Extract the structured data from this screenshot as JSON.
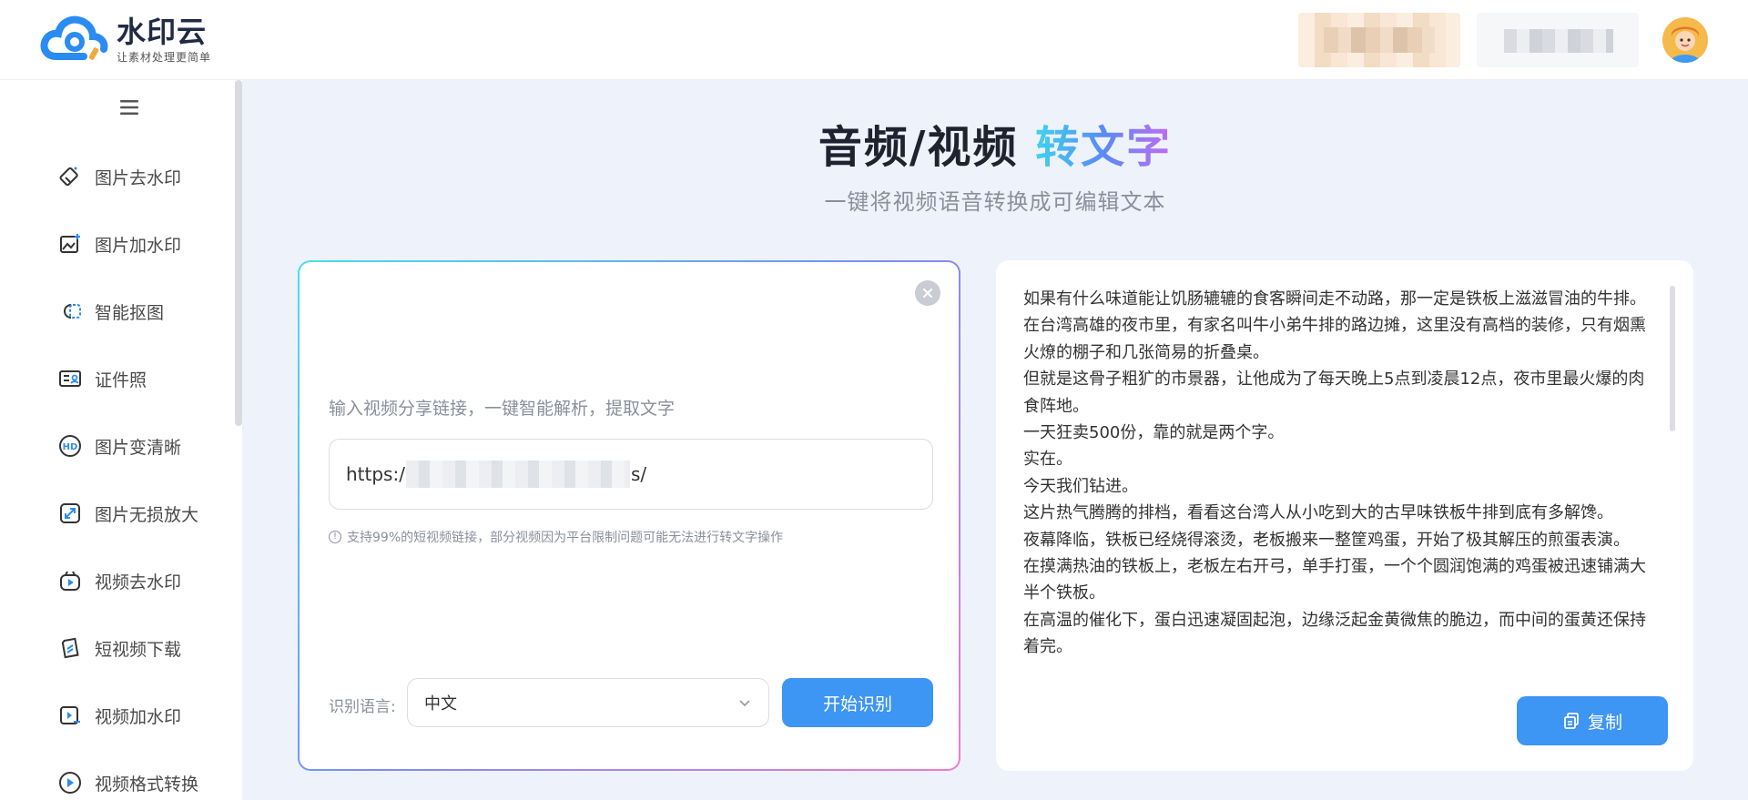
{
  "header": {
    "logo_name": "水印云",
    "logo_slogan": "让素材处理更简单"
  },
  "sidebar": {
    "items": [
      {
        "label": "图片去水印",
        "icon": "eraser-icon"
      },
      {
        "label": "图片加水印",
        "icon": "image-add-icon"
      },
      {
        "label": "智能抠图",
        "icon": "cutout-icon"
      },
      {
        "label": "证件照",
        "icon": "id-card-icon"
      },
      {
        "label": "图片变清晰",
        "icon": "hd-icon"
      },
      {
        "label": "图片无损放大",
        "icon": "enlarge-icon"
      },
      {
        "label": "视频去水印",
        "icon": "video-eraser-icon"
      },
      {
        "label": "短视频下载",
        "icon": "download-icon"
      },
      {
        "label": "视频加水印",
        "icon": "video-add-icon"
      },
      {
        "label": "视频格式转换",
        "icon": "convert-icon"
      }
    ]
  },
  "main": {
    "title_plain": "音频/视频 ",
    "title_grad": "转文字",
    "subtitle": "一键将视频语音转换成可编辑文本",
    "hint": "输入视频分享链接，一键智能解析，提取文字",
    "url_prefix": "https:/",
    "url_suffix": "s/",
    "note": "支持99%的短视频链接，部分视频因为平台限制问题可能无法进行转文字操作",
    "lang_label": "识别语言:",
    "lang_value": "中文",
    "start_label": "开始识别",
    "copy_label": "复制"
  },
  "transcript": [
    "如果有什么味道能让饥肠辘辘的食客瞬间走不动路，那一定是铁板上滋滋冒油的牛排。",
    "在台湾高雄的夜市里，有家名叫牛小弟牛排的路边摊，这里没有高档的装修，只有烟熏火燎的棚子和几张简易的折叠桌。",
    "但就是这骨子粗犷的市景器，让他成为了每天晚上5点到凌晨12点，夜市里最火爆的肉食阵地。",
    "一天狂卖500份，靠的就是两个字。",
    "实在。",
    "今天我们钻进。",
    "这片热气腾腾的排档，看看这台湾人从小吃到大的古早味铁板牛排到底有多解馋。",
    "夜幕降临，铁板已经烧得滚烫，老板搬来一整筐鸡蛋，开始了极其解压的煎蛋表演。",
    "在摸满热油的铁板上，老板左右开弓，单手打蛋，一个个圆润饱满的鸡蛋被迅速铺满大半个铁板。",
    "在高温的催化下，蛋白迅速凝固起泡，边缘泛起金黄微焦的脆边，而中间的蛋黄还保持着完。"
  ]
}
